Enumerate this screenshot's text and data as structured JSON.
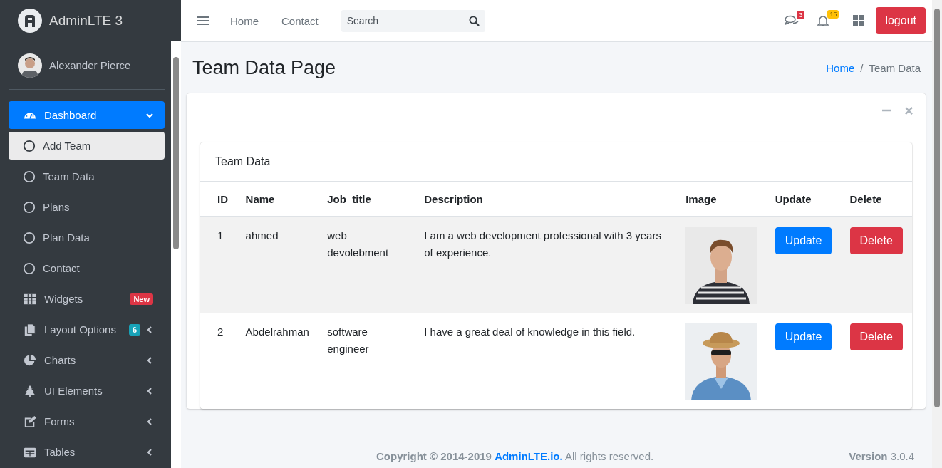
{
  "brand": {
    "name": "AdminLTE 3"
  },
  "user": {
    "name": "Alexander Pierce"
  },
  "sidebar": {
    "items": [
      {
        "label": "Dashboard",
        "selected": true,
        "expanded": true,
        "children": [
          {
            "label": "Add Team",
            "selected": true
          },
          {
            "label": "Team Data",
            "selected": false
          },
          {
            "label": "Plans",
            "selected": false
          },
          {
            "label": "Plan Data",
            "selected": false
          },
          {
            "label": "Contact",
            "selected": false
          }
        ]
      },
      {
        "label": "Widgets",
        "selected": false,
        "badge": {
          "text": "New",
          "color": "#dc3545"
        }
      },
      {
        "label": "Layout Options",
        "selected": false,
        "expanded": false,
        "badge": {
          "text": "6",
          "color": "#17a2b8"
        }
      },
      {
        "label": "Charts",
        "selected": false,
        "expanded": false
      },
      {
        "label": "UI Elements",
        "selected": false,
        "expanded": false
      },
      {
        "label": "Forms",
        "selected": false,
        "expanded": false
      },
      {
        "label": "Tables",
        "selected": false,
        "expanded": false
      }
    ]
  },
  "navbar": {
    "links": [
      "Home",
      "Contact"
    ],
    "search": {
      "placeholder": "Search"
    },
    "messages_badge": {
      "text": "3",
      "color": "#dc3545"
    },
    "notifications_badge": {
      "text": "15",
      "color": "#ffc107"
    },
    "logout": "logout"
  },
  "page": {
    "title": "Team Data Page",
    "breadcrumb_separator": "/",
    "breadcrumb": [
      {
        "label": "Home",
        "link": true
      },
      {
        "label": "Team Data",
        "link": false
      }
    ]
  },
  "table_card": {
    "title": "Team Data",
    "columns": [
      "ID",
      "Name",
      "Job_title",
      "Description",
      "Image",
      "Update",
      "Delete"
    ],
    "rows": [
      {
        "id": "1",
        "name": "ahmed",
        "job_title": "web devolebment",
        "description": "I am a web development professional with 3 years of experience.",
        "update": "Update",
        "delete": "Delete",
        "highlighted": true
      },
      {
        "id": "2",
        "name": "Abdelrahman",
        "job_title": "software engineer",
        "description": "I have a great deal of knowledge in this field.",
        "update": "Update",
        "delete": "Delete",
        "highlighted": false
      }
    ]
  },
  "footer": {
    "copyright": "Copyright © 2014-2019",
    "link": "AdminLTE.io.",
    "rest": "All rights reserved.",
    "version_label": "Version",
    "version": "3.0.4"
  }
}
